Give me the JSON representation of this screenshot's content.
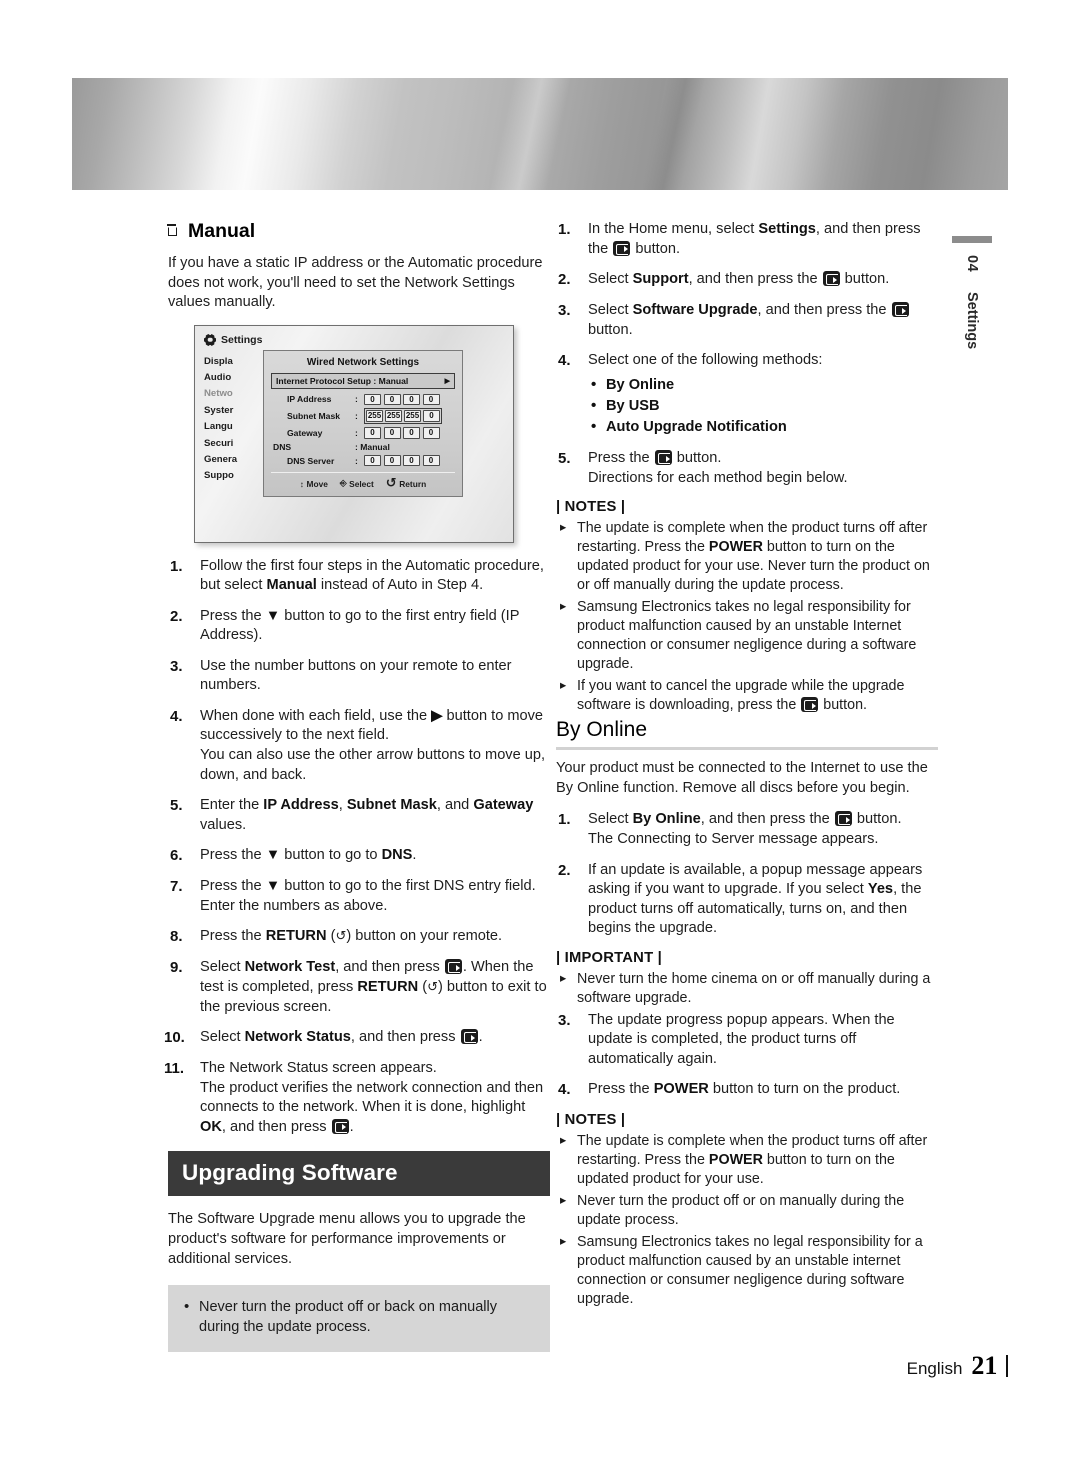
{
  "sidetab": {
    "chapter": "04",
    "name": "Settings"
  },
  "footer": {
    "language": "English",
    "page": "21"
  },
  "left": {
    "manual_heading": "Manual",
    "manual_intro": "If you have a static IP address or the Automatic procedure does not work, you'll need to set the Network Settings values manually.",
    "figure": {
      "title": "Settings",
      "menu": [
        "Displa",
        "Audio",
        "Netwo",
        "Syster",
        "Langu",
        "Securi",
        "Genera",
        "Suppo"
      ],
      "dimmed_index": 2,
      "dialog_title": "Wired Network Settings",
      "ip_setup_label": "Internet Protocol Setup",
      "ip_setup_value": ": Manual",
      "rows": [
        {
          "label": "IP Address",
          "octets": [
            "0",
            "0",
            "0",
            "0"
          ],
          "framed": false
        },
        {
          "label": "Subnet Mask",
          "octets": [
            "255",
            "255",
            "255",
            "0"
          ],
          "framed": true
        },
        {
          "label": "Gateway",
          "octets": [
            "0",
            "0",
            "0",
            "0"
          ],
          "framed": false
        }
      ],
      "dns_label": "DNS",
      "dns_value": ": Manual",
      "dns_server_label": "DNS Server",
      "dns_server_octets": [
        "0",
        "0",
        "0",
        "0"
      ],
      "foot": {
        "move": "Move",
        "select": "Select",
        "return": "Return"
      }
    },
    "steps": [
      {
        "n": "1.",
        "html": "Follow the first four steps in the Automatic procedure, but select <b>Manual</b> instead of Auto in Step 4."
      },
      {
        "n": "2.",
        "html": "Press the <b>▼</b> button to go to the first entry field (IP Address)."
      },
      {
        "n": "3.",
        "html": "Use the number buttons on your remote to enter numbers."
      },
      {
        "n": "4.",
        "html": "When done with each field, use the <b>▶</b> button to move successively to the next field.<br>You can also use the other arrow buttons to move up, down, and back."
      },
      {
        "n": "5.",
        "html": "Enter the <b>IP Address</b>, <b>Subnet Mask</b>, and <b>Gateway</b> values."
      },
      {
        "n": "6.",
        "html": "Press the <b>▼</b> button to go to <b>DNS</b>."
      },
      {
        "n": "7.",
        "html": "Press the <b>▼</b> button to go to the first DNS entry field. Enter the numbers as above."
      },
      {
        "n": "8.",
        "html": "Press the <b>RETURN</b> (<span class=\"ret\">↺</span>) button on your remote."
      },
      {
        "n": "9.",
        "html": "Select <b>Network Test</b>, and then press <span class=\"ent\"></span>. When the test is completed, press <b>RETURN</b> (<span class=\"ret\">↺</span>) button to exit to the previous screen."
      },
      {
        "n": "10.",
        "html": "Select <b>Network Status</b>, and then press <span class=\"ent\"></span>."
      },
      {
        "n": "11.",
        "html": "The Network Status screen appears.<br>The product verifies the network connection and then connects to the network. When it is done, highlight <b>OK</b>, and then press <span class=\"ent\"></span>."
      }
    ],
    "upgrading_heading": "Upgrading Software",
    "upgrading_intro": "The Software Upgrade menu allows you to upgrade the product's software for performance improvements or additional services.",
    "caution_bullets": [
      "Never turn the product off or back on manually during the update process."
    ]
  },
  "right": {
    "steps": [
      {
        "n": "1.",
        "html": "In the Home menu, select <b>Settings</b>, and then press the <span class=\"ent\"></span> button."
      },
      {
        "n": "2.",
        "html": "Select <b>Support</b>, and then press the <span class=\"ent\"></span> button."
      },
      {
        "n": "3.",
        "html": "Select <b>Software Upgrade</b>, and then press the <span class=\"ent\"></span> button."
      },
      {
        "n": "4.",
        "html": "Select one of the following methods:",
        "sub": [
          "By Online",
          "By USB",
          "Auto Upgrade Notification"
        ]
      },
      {
        "n": "5.",
        "html": "Press the <span class=\"ent\"></span> button.<br>Directions for each method begin below."
      }
    ],
    "notes_title_1": "| NOTES |",
    "notes_1": [
      "The update is complete when the product turns off after restarting. Press the <b>POWER</b> button to turn on the updated product for your use. Never turn the product on or off manually during the update process.",
      "Samsung Electronics takes no legal responsibility for product malfunction caused by an unstable Internet connection or consumer negligence during a software upgrade.",
      "If you want to cancel the upgrade while the upgrade software is downloading, press the <span class=\"ent\"></span> button."
    ],
    "byonline_heading": "By Online",
    "byonline_intro": "Your product must be connected to the Internet to use the By Online function. Remove all discs before you begin.",
    "byonline_steps_a": [
      {
        "n": "1.",
        "html": "Select <b>By Online</b>, and then press the <span class=\"ent\"></span> button.<br>The Connecting to Server message appears."
      },
      {
        "n": "2.",
        "html": "If an update is available, a popup message appears asking if you want to upgrade. If you select <b>Yes</b>, the product turns off automatically, turns on, and then begins the upgrade."
      }
    ],
    "important_title": "| IMPORTANT |",
    "important_notes": [
      "Never turn the home cinema on or off manually during a software upgrade."
    ],
    "byonline_steps_b": [
      {
        "n": "3.",
        "html": "The update progress popup appears. When the update is completed, the product turns off automatically again."
      },
      {
        "n": "4.",
        "html": "Press the <b>POWER</b> button to turn on the product."
      }
    ],
    "notes_title_2": "| NOTES |",
    "notes_2": [
      "The update is complete when the product turns off after restarting. Press the <b>POWER</b> button to turn on the updated product for your use.",
      "Never turn the product off or on manually during the update process.",
      "Samsung Electronics takes no legal responsibility for a product malfunction caused by an unstable internet connection or consumer negligence during software upgrade."
    ]
  }
}
